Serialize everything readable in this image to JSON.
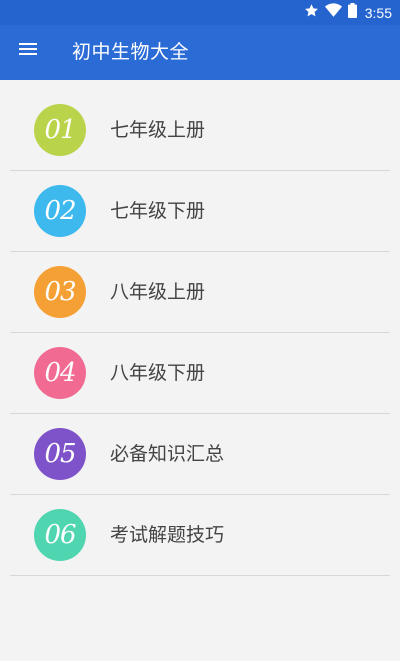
{
  "status_bar": {
    "time": "3:55",
    "icons": [
      "star-icon",
      "wifi-icon",
      "battery-icon"
    ]
  },
  "app_bar": {
    "title": "初中生物大全",
    "menu_icon": "menu-icon",
    "color": "#2b6bd6"
  },
  "list": {
    "items": [
      {
        "number": "01",
        "label": "七年级上册",
        "color": "#b9d44a"
      },
      {
        "number": "02",
        "label": "七年级下册",
        "color": "#3db9ee"
      },
      {
        "number": "03",
        "label": "八年级上册",
        "color": "#f5a034"
      },
      {
        "number": "04",
        "label": "八年级下册",
        "color": "#f06a92"
      },
      {
        "number": "05",
        "label": "必备知识汇总",
        "color": "#7e52c9"
      },
      {
        "number": "06",
        "label": "考试解题技巧",
        "color": "#4fd6b0"
      }
    ]
  }
}
